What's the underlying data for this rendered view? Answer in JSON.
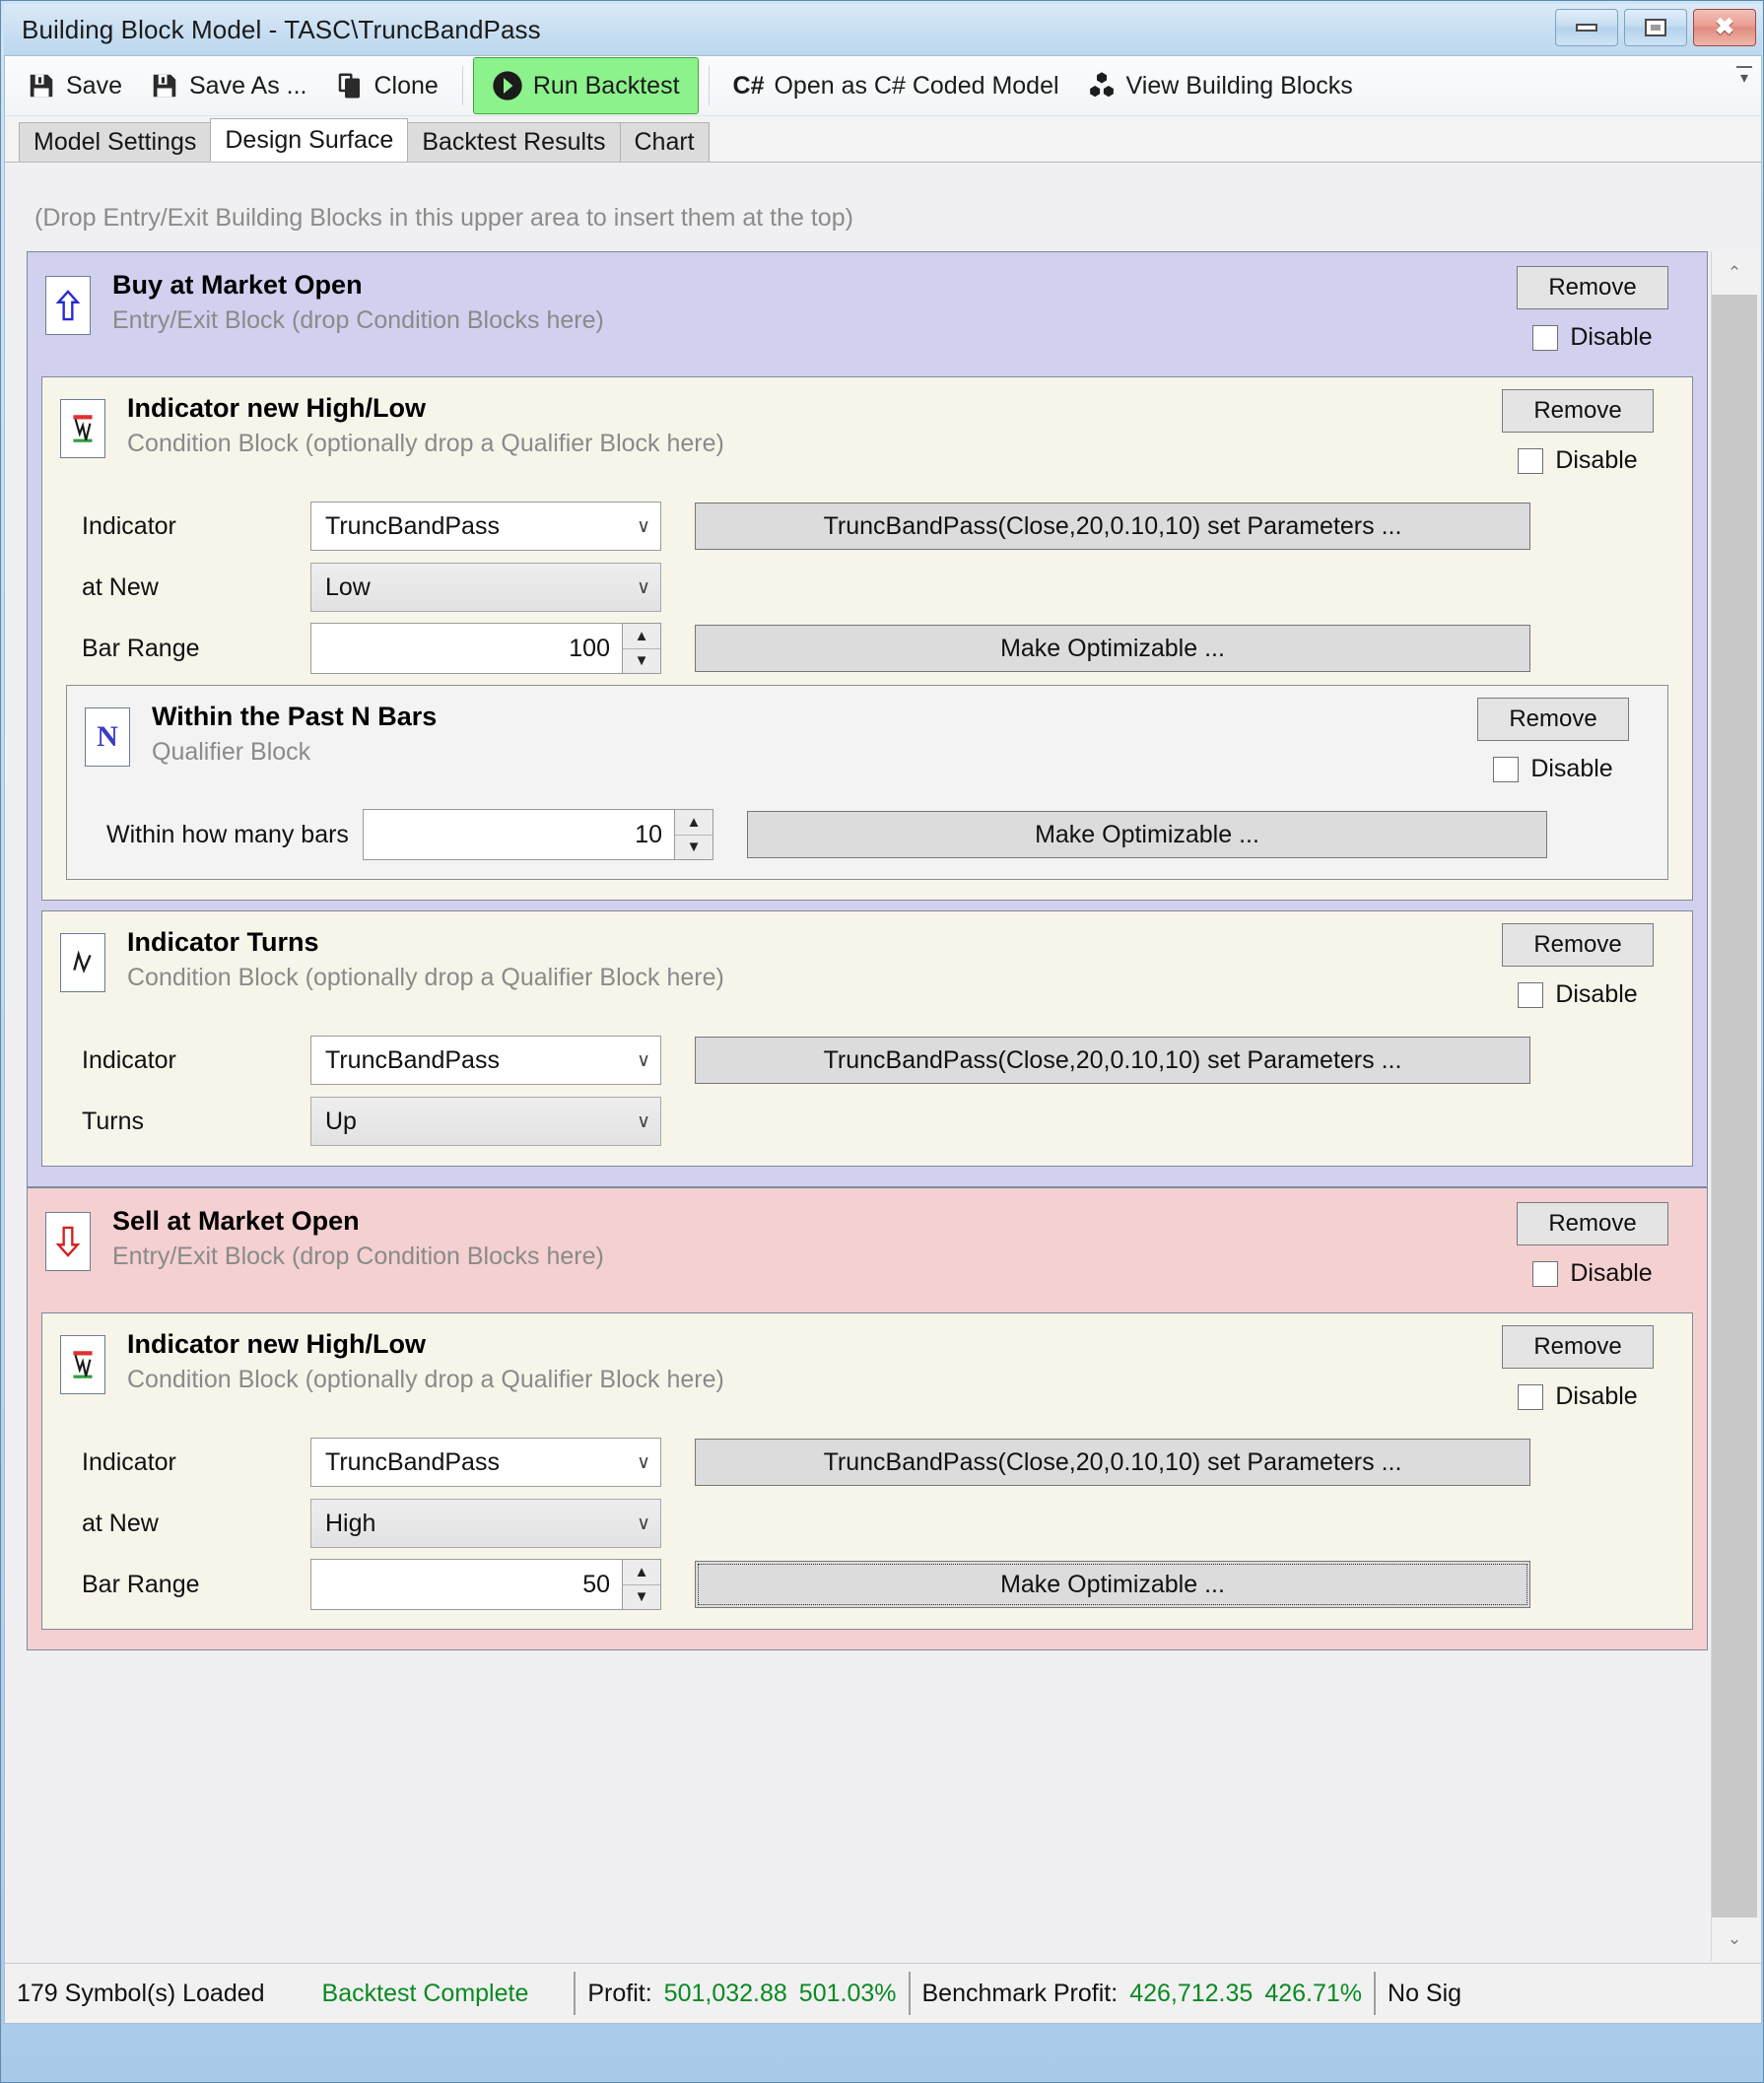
{
  "window": {
    "title": "Building Block Model - TASC\\TruncBandPass",
    "controls": {
      "minimize": "–",
      "maximize": "□",
      "close": "✕"
    }
  },
  "toolbar": {
    "save": "Save",
    "save_as": "Save As ...",
    "clone": "Clone",
    "run_backtest": "Run Backtest",
    "open_csharp": "Open as C# Coded Model",
    "csharp_mark": "C#",
    "view_building_blocks": "View Building Blocks",
    "overflow": "▾"
  },
  "tabs": [
    {
      "label": "Model Settings",
      "active": false
    },
    {
      "label": "Design Surface",
      "active": true
    },
    {
      "label": "Backtest Results",
      "active": false
    },
    {
      "label": "Chart",
      "active": false
    }
  ],
  "surface": {
    "drop_hint": "(Drop Entry/Exit Building Blocks in this upper area to insert them at the top)"
  },
  "common": {
    "remove": "Remove",
    "disable": "Disable",
    "caret": "∨",
    "up_arrow": "▲",
    "down_arrow": "▼",
    "scroll_up": "⌃",
    "scroll_down": "⌄"
  },
  "buy_block": {
    "title": "Buy at Market Open",
    "subtitle": "Entry/Exit Block (drop Condition Blocks here)",
    "icon": "blue-up-arrow-icon",
    "remove": "Remove",
    "disable": "Disable",
    "disable_checked": false
  },
  "cond_high_low_buy": {
    "title": "Indicator new High/Low",
    "subtitle": "Condition Block (optionally drop a Qualifier Block here)",
    "icon": "indicator-high-low-icon",
    "remove": "Remove",
    "disable": "Disable",
    "rows": {
      "indicator_label": "Indicator",
      "indicator_value": "TruncBandPass",
      "at_new_label": "at New",
      "at_new_value": "Low",
      "bar_range_label": "Bar Range",
      "bar_range_value": "100"
    },
    "set_parameters": "TruncBandPass(Close,20,0.10,10) set Parameters ...",
    "make_optimizable": "Make Optimizable ..."
  },
  "qualifier_n_bars": {
    "title": "Within the Past N Bars",
    "subtitle": "Qualifier Block",
    "icon": "letter-n-icon",
    "remove": "Remove",
    "disable": "Disable",
    "bars_label": "Within how many bars",
    "bars_value": "10",
    "make_optimizable": "Make Optimizable ..."
  },
  "cond_turns": {
    "title": "Indicator Turns",
    "subtitle": "Condition Block (optionally drop a Qualifier Block here)",
    "icon": "indicator-turns-icon",
    "remove": "Remove",
    "disable": "Disable",
    "rows": {
      "indicator_label": "Indicator",
      "indicator_value": "TruncBandPass",
      "turns_label": "Turns",
      "turns_value": "Up"
    },
    "set_parameters": "TruncBandPass(Close,20,0.10,10) set Parameters ..."
  },
  "sell_block": {
    "title": "Sell at Market Open",
    "subtitle": "Entry/Exit Block (drop Condition Blocks here)",
    "icon": "red-down-arrow-icon",
    "remove": "Remove",
    "disable": "Disable"
  },
  "cond_high_low_sell": {
    "title": "Indicator new High/Low",
    "subtitle": "Condition Block (optionally drop a Qualifier Block here)",
    "icon": "indicator-high-low-icon",
    "remove": "Remove",
    "disable": "Disable",
    "rows": {
      "indicator_label": "Indicator",
      "indicator_value": "TruncBandPass",
      "at_new_label": "at New",
      "at_new_value": "High",
      "bar_range_label": "Bar Range",
      "bar_range_value": "50"
    },
    "set_parameters": "TruncBandPass(Close,20,0.10,10) set Parameters ...",
    "make_optimizable": "Make Optimizable ..."
  },
  "statusbar": {
    "symbols_loaded": "179 Symbol(s) Loaded",
    "backtest_state": "Backtest Complete",
    "profit_label": "Profit:",
    "profit_value": "501,032.88",
    "profit_pct": "501.03%",
    "benchmark_label": "Benchmark Profit:",
    "benchmark_value": "426,712.35",
    "benchmark_pct": "426.71%",
    "signal_text": "No Sig"
  },
  "colors": {
    "buy_block": "#d2d0ef",
    "sell_block": "#f4d0d0",
    "condition_block": "#f7f4ea",
    "run_backtest": "#8cf28c",
    "status_green": "#0a8a22"
  }
}
